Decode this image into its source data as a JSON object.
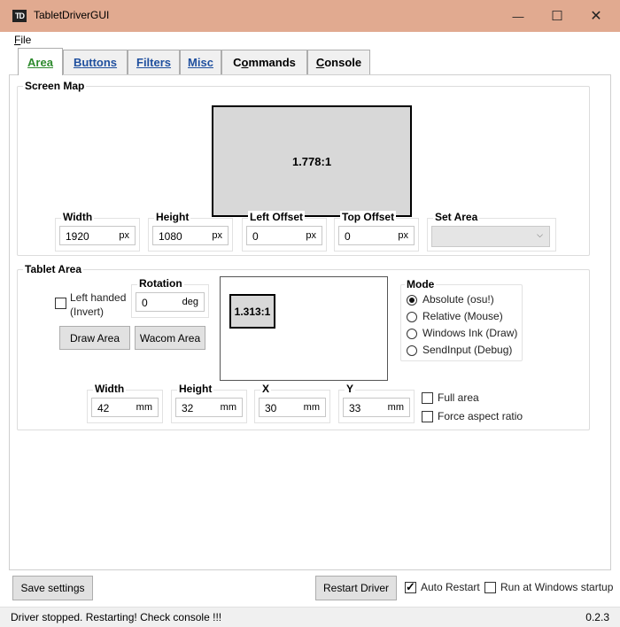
{
  "window": {
    "icon_text": "TD",
    "title": "TabletDriverGUI",
    "minimize_glyph": "—",
    "maximize_glyph": "☐",
    "close_glyph": "✕"
  },
  "menu": {
    "file_underline": "F",
    "file_rest": "ile"
  },
  "tabs": [
    {
      "u": "A",
      "rest": "rea"
    },
    {
      "u": "B",
      "rest": "uttons"
    },
    {
      "u": "F",
      "rest": "ilters"
    },
    {
      "u": "M",
      "rest": "isc"
    },
    {
      "pre": "C",
      "u": "o",
      "rest": "mmands"
    },
    {
      "pre": "",
      "u": "C",
      "rest": "onsole"
    }
  ],
  "screen_map": {
    "title": "Screen Map",
    "aspect": "1.778:1",
    "width": {
      "label": "Width",
      "value": "1920",
      "unit": "px"
    },
    "height": {
      "label": "Height",
      "value": "1080",
      "unit": "px"
    },
    "left_offset": {
      "label": "Left Offset",
      "value": "0",
      "unit": "px"
    },
    "top_offset": {
      "label": "Top Offset",
      "value": "0",
      "unit": "px"
    },
    "set_area": {
      "label": "Set Area",
      "selected": ""
    }
  },
  "tablet_area": {
    "title": "Tablet Area",
    "left_handed_line1": "Left handed",
    "left_handed_line2": "(Invert)",
    "left_handed_checked": false,
    "rotation": {
      "label": "Rotation",
      "value": "0",
      "unit": "deg"
    },
    "draw_area_button": "Draw Area",
    "wacom_area_button": "Wacom Area",
    "aspect": "1.313:1",
    "mode": {
      "label": "Mode",
      "options": [
        "Absolute (osu!)",
        "Relative (Mouse)",
        "Windows Ink (Draw)",
        "SendInput (Debug)"
      ],
      "selected_index": 0
    },
    "width": {
      "label": "Width",
      "value": "42",
      "unit": "mm"
    },
    "height": {
      "label": "Height",
      "value": "32",
      "unit": "mm"
    },
    "x": {
      "label": "X",
      "value": "30",
      "unit": "mm"
    },
    "y": {
      "label": "Y",
      "value": "33",
      "unit": "mm"
    },
    "full_area": {
      "label": "Full area",
      "checked": false
    },
    "force_aspect": {
      "label": "Force aspect ratio",
      "checked": false
    }
  },
  "bottom": {
    "save_settings": "Save settings",
    "restart_driver": "Restart Driver",
    "auto_restart": {
      "label": "Auto Restart",
      "checked": true
    },
    "run_at_startup": {
      "label": "Run at Windows startup",
      "checked": false
    }
  },
  "status": {
    "message": "Driver stopped. Restarting! Check console !!!",
    "version": "0.2.3"
  }
}
